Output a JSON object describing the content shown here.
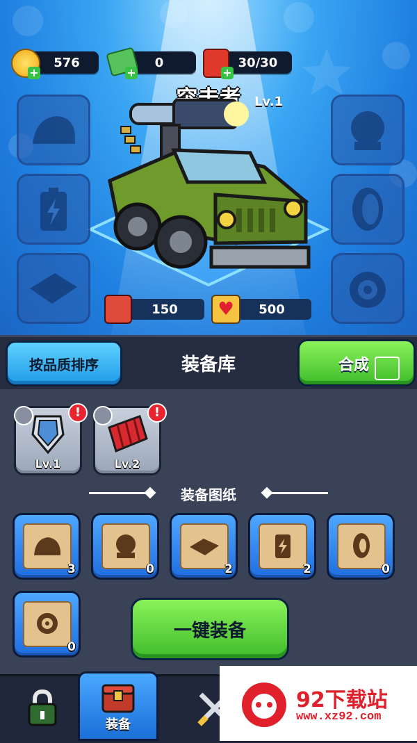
{
  "resources": {
    "coins": "576",
    "cash": "0",
    "fuel": "30/30"
  },
  "vehicle": {
    "name": "突击者",
    "level": "Lv.1",
    "attack": "150",
    "hp": "500"
  },
  "panel": {
    "sort_button": "按品质排序",
    "title": "装备库",
    "merge_button": "合成"
  },
  "items": [
    {
      "level": "Lv.1",
      "icon": "shield-icon"
    },
    {
      "level": "Lv.2",
      "icon": "armor-icon"
    }
  ],
  "blueprints": {
    "section_title": "装备图纸",
    "list": [
      {
        "icon": "helmet-icon",
        "count": "3"
      },
      {
        "icon": "engine-icon",
        "count": "0"
      },
      {
        "icon": "plate-icon",
        "count": "2"
      },
      {
        "icon": "battery-icon",
        "count": "2"
      },
      {
        "icon": "tire-icon",
        "count": "0"
      },
      {
        "icon": "gauge-icon",
        "count": "0"
      }
    ]
  },
  "equip_all_button": "一键装备",
  "tabs": [
    {
      "label": "",
      "icon": "lock-icon"
    },
    {
      "label": "装备",
      "icon": "chest-icon"
    },
    {
      "label": "",
      "icon": "swords-icon"
    }
  ],
  "watermark": {
    "brand": "92下载站",
    "url": "www.xz92.com"
  }
}
